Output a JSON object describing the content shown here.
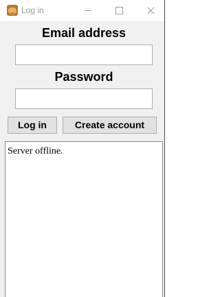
{
  "window": {
    "title": "Log in",
    "icon": "app-face-icon",
    "controls": [
      "minimize-icon",
      "maximize-icon",
      "close-icon"
    ]
  },
  "form": {
    "email_label": "Email address",
    "email_value": "",
    "password_label": "Password",
    "password_value": ""
  },
  "buttons": {
    "login_label": "Log in",
    "create_account_label": "Create account"
  },
  "status": {
    "message": "Server offline."
  },
  "colors": {
    "window_background": "#f0f0f0",
    "titlebar_background": "#ffffff",
    "title_text": "#999999",
    "button_background": "#e1e1e1",
    "border": "#adadad"
  }
}
